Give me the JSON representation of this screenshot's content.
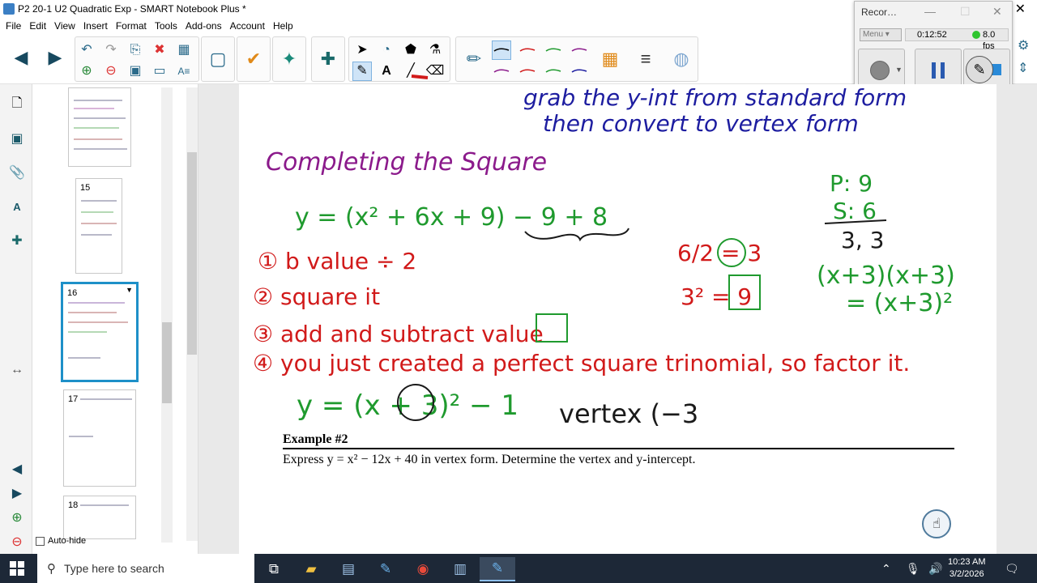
{
  "window": {
    "title": "P2 20-1 U2 Quadratic Exp - SMART Notebook Plus *",
    "close_glyph": "✕"
  },
  "menu": [
    "File",
    "Edit",
    "View",
    "Insert",
    "Format",
    "Tools",
    "Add-ons",
    "Account",
    "Help"
  ],
  "recorder": {
    "title": "Recor…",
    "menu_label": "Menu",
    "elapsed": "0:12:52",
    "fps": "8.0 fps",
    "status_color": "#2ec52e"
  },
  "sidebar": {
    "autohide_label": "Auto-hide"
  },
  "thumbnails": [
    {
      "num": "15"
    },
    {
      "num": "16",
      "selected": true
    },
    {
      "num": "17"
    },
    {
      "num": "18"
    }
  ],
  "ink": {
    "line_top_1": "grab the y-int from standard form",
    "line_top_2": "then convert to vertex form",
    "heading": "Completing the Square",
    "equation": "y = (x² + 6x + 9) − 9 + 8",
    "step1": "① b value ÷ 2",
    "step2": "② square it",
    "step3": "③ add and subtract value",
    "step4": "④ you just created a perfect square trinomial, so factor it.",
    "result": "y = (x + 3)² − 1",
    "vertex": "vertex (−3",
    "calc_half": "6/2 = 3",
    "calc_square": "3² = 9",
    "pq": "P: 9",
    "sum": "S: 6",
    "factors": "3, 3",
    "product": "(x+3)(x+3)",
    "square_form": "= (x+3)²"
  },
  "example": {
    "title": "Example #2",
    "text": "Express y = x² − 12x + 40 in vertex form.  Determine the vertex and y-intercept."
  },
  "colors": {
    "purple": "#8b1a8b",
    "blue": "#1d1da0",
    "red": "#d11a1a",
    "green": "#1f9a2e",
    "black": "#1a1a1a"
  },
  "taskbar": {
    "search_placeholder": "Type here to search",
    "time": "10:23 AM",
    "date": "3/2/2026"
  }
}
